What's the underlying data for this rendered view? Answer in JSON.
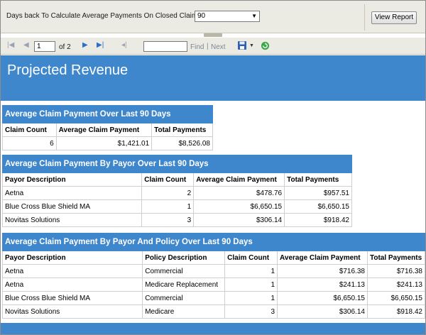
{
  "params": {
    "label": "Days back To Calculate Average Payments On Closed Claims",
    "selected": "90",
    "view_report": "View Report"
  },
  "toolbar": {
    "first_icon": "first-page-icon",
    "prev_icon": "previous-page-icon",
    "page": "1",
    "of_label": "of 2",
    "next_icon": "next-page-icon",
    "last_icon": "last-page-icon",
    "back_icon": "back-icon",
    "find": "Find",
    "separator": "|",
    "next": "Next",
    "export_icon": "save-icon",
    "refresh_icon": "refresh-icon"
  },
  "report": {
    "title": "Projected Revenue"
  },
  "table1": {
    "title": "Average Claim Payment Over Last  90 Days",
    "headers": [
      "Claim Count",
      "Average Claim Payment",
      "Total Payments"
    ],
    "rows": [
      [
        "6",
        "$1,421.01",
        "$8,526.08"
      ]
    ]
  },
  "table2": {
    "title": "Average Claim Payment By Payor Over Last  90 Days",
    "headers": [
      "Payor Description",
      "Claim Count",
      "Average Claim Payment",
      "Total Payments"
    ],
    "rows": [
      [
        "Aetna",
        "2",
        "$478.76",
        "$957.51"
      ],
      [
        "Blue Cross Blue Shield MA",
        "1",
        "$6,650.15",
        "$6,650.15"
      ],
      [
        "Novitas Solutions",
        "3",
        "$306.14",
        "$918.42"
      ]
    ]
  },
  "table3": {
    "title": "Average Claim Payment By Payor And Policy Over Last  90 Days",
    "headers": [
      "Payor Description",
      "Policy Description",
      "Claim Count",
      "Average Claim Payment",
      "Total Payments"
    ],
    "rows": [
      [
        "Aetna",
        "Commercial",
        "1",
        "$716.38",
        "$716.38"
      ],
      [
        "Aetna",
        "Medicare Replacement",
        "1",
        "$241.13",
        "$241.13"
      ],
      [
        "Blue Cross Blue Shield MA",
        "Commercial",
        "1",
        "$6,650.15",
        "$6,650.15"
      ],
      [
        "Novitas Solutions",
        "Medicare",
        "3",
        "$306.14",
        "$918.42"
      ]
    ]
  },
  "colors": {
    "header_blue": "#3f87cc",
    "toolbar_bg": "#ecebe3"
  }
}
